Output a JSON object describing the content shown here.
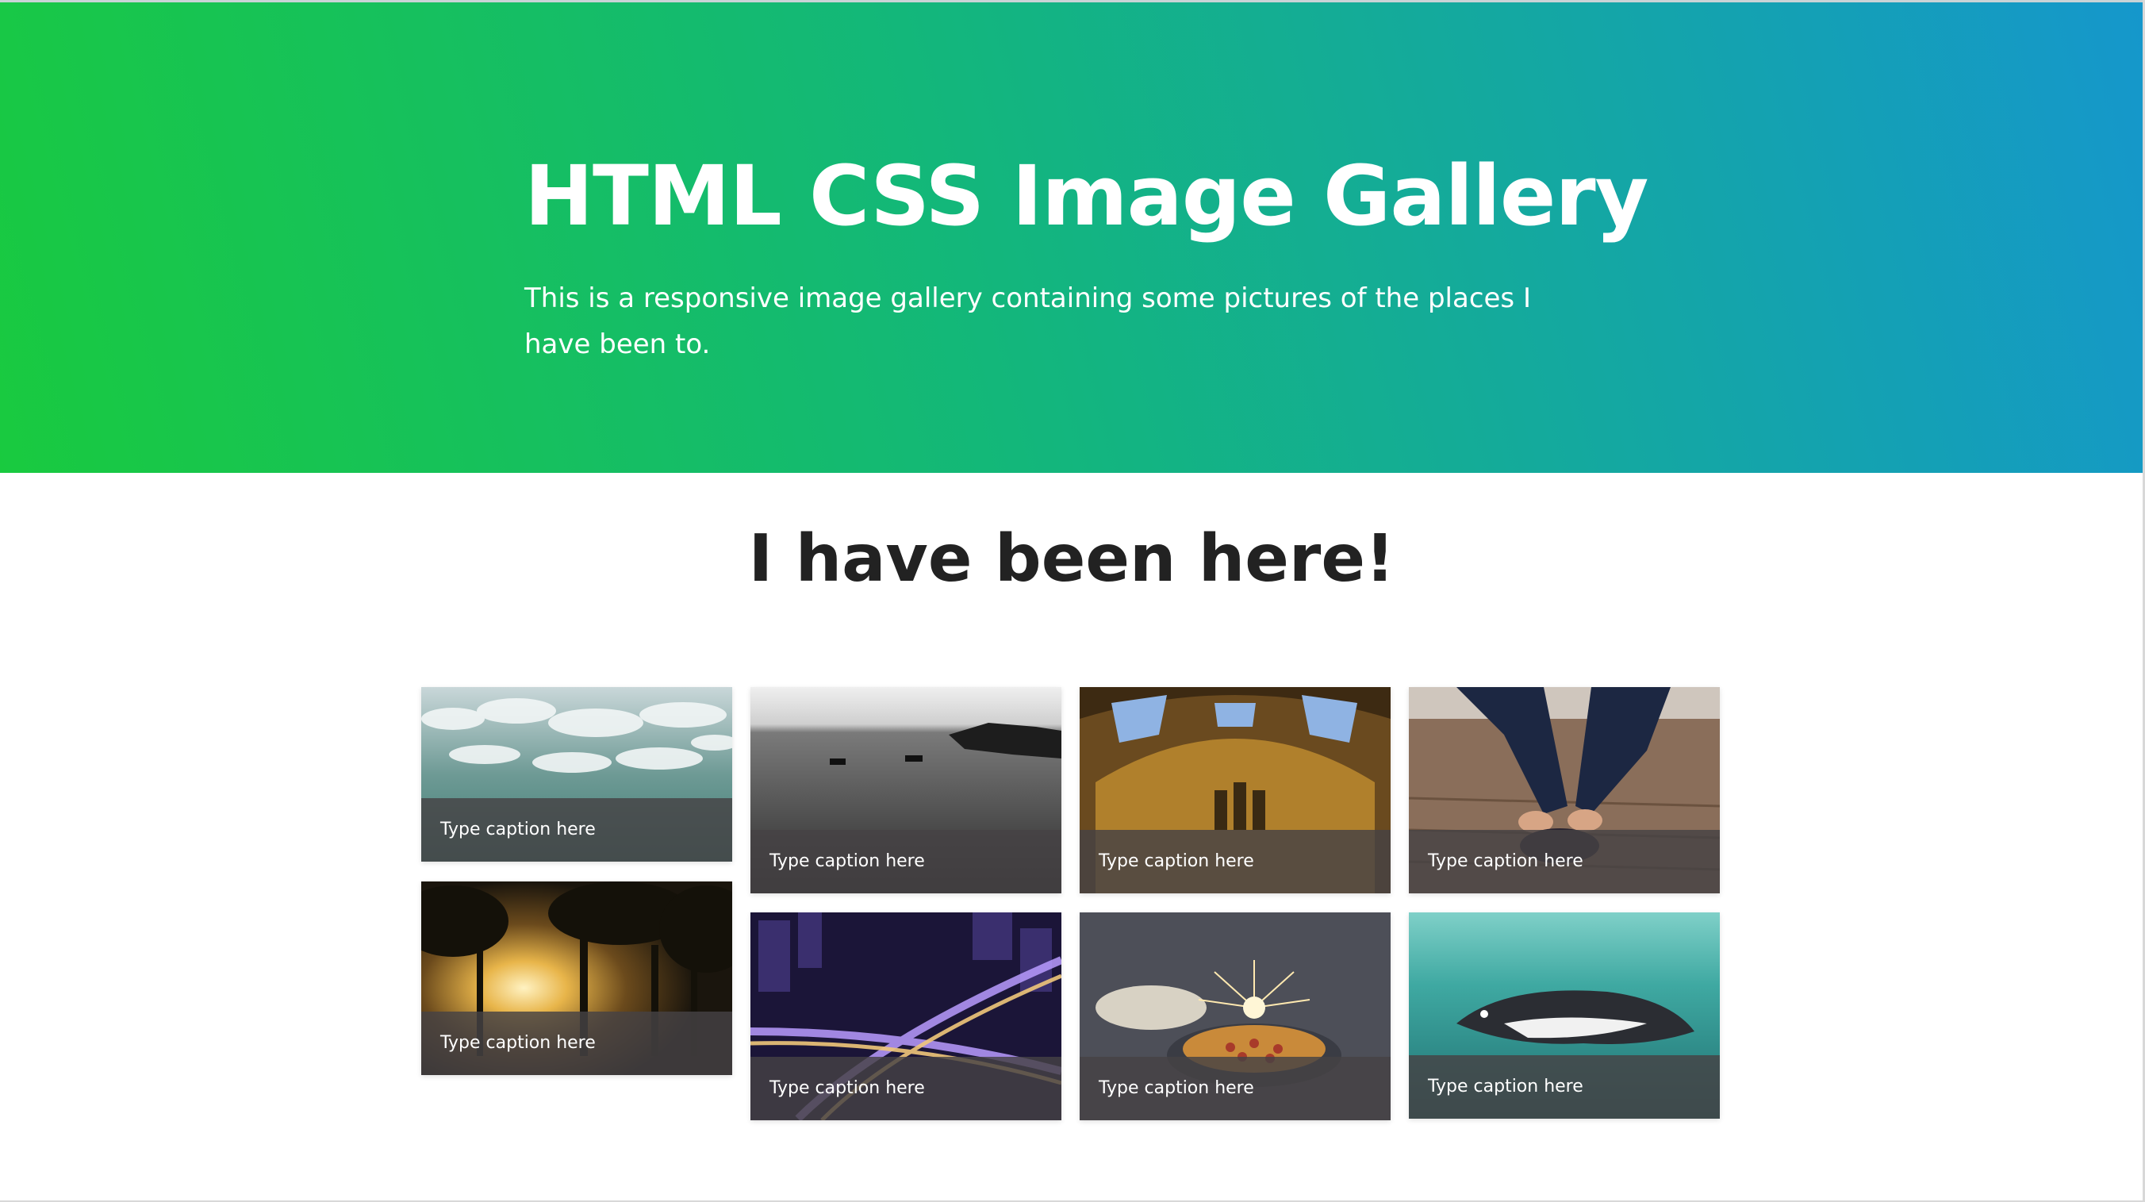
{
  "hero": {
    "title": "HTML CSS Image Gallery",
    "description": "This is a responsive image gallery containing some pictures of the places I have been to."
  },
  "gallery": {
    "heading": "I have been here!",
    "items": [
      {
        "subject": "ocean-waves-aerial",
        "caption": "Type caption here"
      },
      {
        "subject": "forest-sunlight",
        "caption": "Type caption here"
      },
      {
        "subject": "sea-boats-monochrome",
        "caption": "Type caption here"
      },
      {
        "subject": "city-interchange-night",
        "caption": "Type caption here"
      },
      {
        "subject": "museum-hall-arches",
        "caption": "Type caption here"
      },
      {
        "subject": "pie-sparklers",
        "caption": "Type caption here"
      },
      {
        "subject": "tying-shoelaces",
        "caption": "Type caption here"
      },
      {
        "subject": "penguin-underwater",
        "caption": "Type caption here"
      }
    ]
  },
  "colors": {
    "gradient_start": "#19ca3f",
    "gradient_end": "#1597cc",
    "caption_overlay": "#464244",
    "heading_text": "#222222"
  }
}
